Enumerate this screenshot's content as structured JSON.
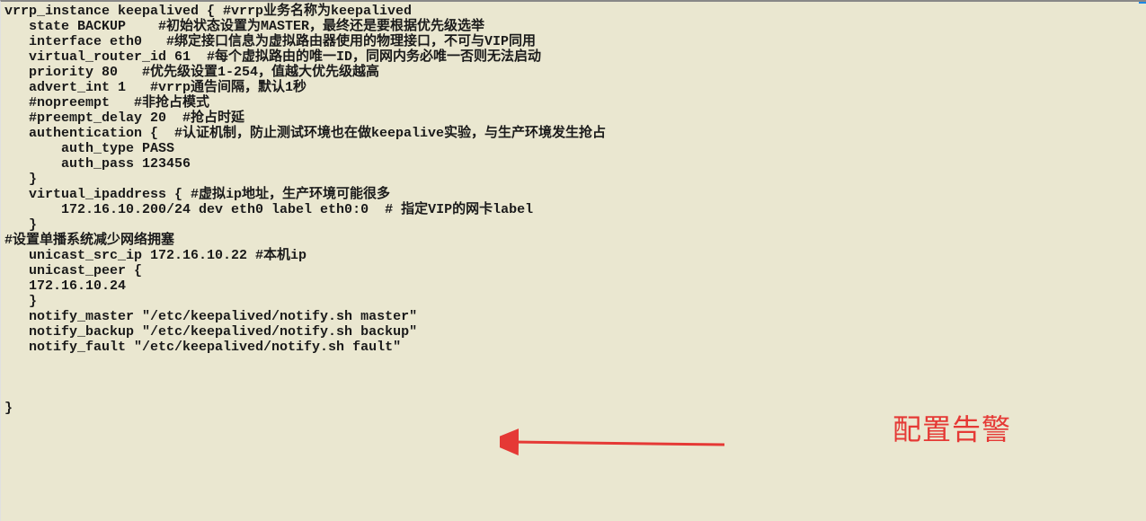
{
  "code": {
    "lines": [
      "vrrp_instance keepalived { #vrrp业务名称为keepalived",
      "   state BACKUP    #初始状态设置为MASTER，最终还是要根据优先级选举",
      "   interface eth0   #绑定接口信息为虚拟路由器使用的物理接口，不可与VIP同用",
      "   virtual_router_id 61  #每个虚拟路由的唯一ID，同网内务必唯一否则无法启动",
      "   priority 80   #优先级设置1-254，值越大优先级越高",
      "   advert_int 1   #vrrp通告间隔，默认1秒",
      "   #nopreempt   #非抢占模式",
      "   #preempt_delay 20  #抢占时延",
      "   authentication {  #认证机制，防止测试环境也在做keepalive实验，与生产环境发生抢占",
      "       auth_type PASS",
      "       auth_pass 123456",
      "   }",
      "   virtual_ipaddress { #虚拟ip地址，生产环境可能很多",
      "       172.16.10.200/24 dev eth0 label eth0:0  # 指定VIP的网卡label",
      "   }",
      "#设置单播系统减少网络拥塞",
      "   unicast_src_ip 172.16.10.22 #本机ip",
      "   unicast_peer {",
      "   172.16.10.24",
      "   }",
      "   notify_master \"/etc/keepalived/notify.sh master\"",
      "   notify_backup \"/etc/keepalived/notify.sh backup\"",
      "   notify_fault \"/etc/keepalived/notify.sh fault\"",
      "",
      "",
      "",
      "}"
    ]
  },
  "annotation": {
    "label": "配置告警",
    "color": "#e53935"
  }
}
